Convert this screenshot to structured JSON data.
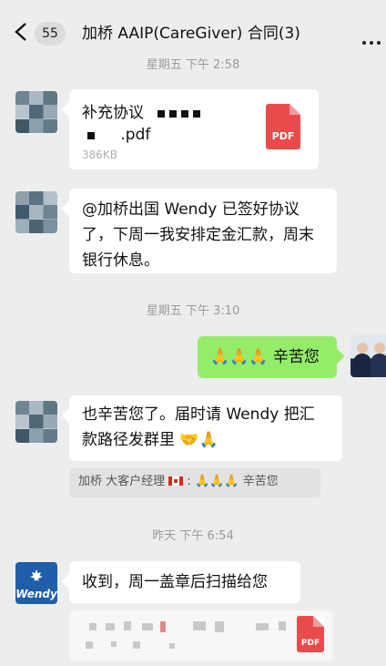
{
  "header": {
    "back_icon": "chevron-left-icon",
    "unread_count": "55",
    "title": "加桥 AAIP(CareGiver) 合同(3)",
    "more_icon": "more-dots-icon"
  },
  "timestamps": {
    "t1": "星期五 下午 2:58",
    "t2": "星期五 下午 3:10",
    "t3": "昨天 下午 6:54"
  },
  "messages": {
    "file1": {
      "name_line1": "补充协议",
      "name_line2": ".pdf",
      "size": "386KB",
      "pdf_label": "PDF"
    },
    "text1": "@加桥出国 Wendy 已签好协议了，下周一我安排定金汇款，周末银行休息。",
    "reply_sent": "辛苦您",
    "reply_sent_emoji": "🙏🙏🙏",
    "text2": "也辛苦您了。届时请 Wendy 把汇款路径发群里",
    "text2_emoji": "🤝🙏",
    "quote_sender": "加桥 大客户经理",
    "quote_text": "辛苦您",
    "quote_emoji": "🙏🙏🙏",
    "text3": "收到，周一盖章后扫描给您",
    "file2": {
      "pdf_label": "PDF"
    },
    "brand_avatar_text": "Wendy"
  },
  "colors": {
    "background": "#ededed",
    "sent_bubble": "#95ec69",
    "received_bubble": "#ffffff",
    "pdf_red": "#e94b4b"
  }
}
